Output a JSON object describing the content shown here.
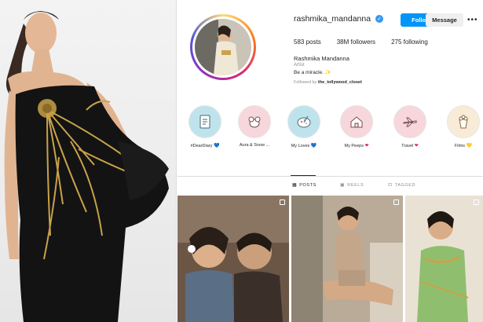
{
  "profile": {
    "username": "rashmika_mandanna",
    "follow_label": "Follow",
    "message_label": "Message",
    "more_label": "•••",
    "posts": "583 posts",
    "followers": "38M followers",
    "following": "275 following",
    "full_name": "Rashmika Mandanna",
    "category": "Artist",
    "bio": "Be a miracle. ✨",
    "followed_by_prefix": "Followed by",
    "followed_by_name": "the_tollywood_closet"
  },
  "highlights": [
    {
      "label": "#DearDiary",
      "heart": "💙",
      "icon": "diary-icon",
      "color": "#bfe3ec"
    },
    {
      "label": "Aura & Snow ...",
      "heart": "",
      "icon": "dog-icon",
      "color": "#f7d6dc"
    },
    {
      "label": "My Loves",
      "heart": "💙",
      "icon": "palette-icon",
      "color": "#bfe3ec"
    },
    {
      "label": "My Peeps",
      "heart": "❤",
      "icon": "house-icon",
      "color": "#f7d6dc"
    },
    {
      "label": "Travel",
      "heart": "❤",
      "icon": "plane-icon",
      "color": "#f7d6dc"
    },
    {
      "label": "Films",
      "heart": "💛",
      "icon": "popcorn-icon",
      "color": "#f8ecd8"
    }
  ],
  "tabs": {
    "posts": "POSTS",
    "reels": "REELS",
    "tagged": "TAGGED"
  },
  "colors": {
    "follow_blue": "#0095f6",
    "verified_blue": "#3897f0"
  }
}
